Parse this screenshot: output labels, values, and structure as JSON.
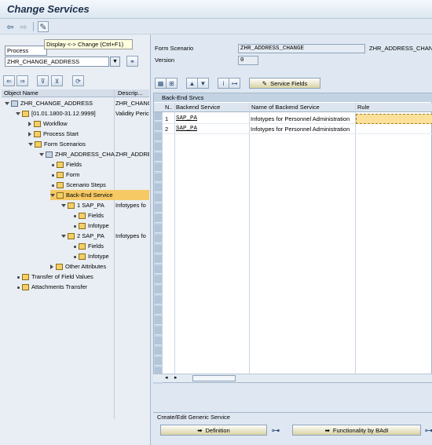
{
  "app": {
    "title": "Change Services"
  },
  "tooltip": "Display <-> Change   (Ctrl+F1)",
  "left": {
    "object_type": "Process",
    "object_value": "ZHR_CHANGE_ADDRESS",
    "tree_headers": {
      "object": "Object Name",
      "desc": "Descrip..."
    },
    "tree": [
      {
        "label": "ZHR_CHANGE_ADDRESS",
        "desc": "ZHR_CHANG"
      },
      {
        "label": "[01.01.1800-31.12.9999]",
        "desc": "Validity Peric"
      },
      {
        "label": "Workflow",
        "desc": ""
      },
      {
        "label": "Process Start",
        "desc": ""
      },
      {
        "label": "Form Scenarios",
        "desc": ""
      },
      {
        "label": "ZHR_ADDRESS_CHA",
        "desc": "ZHR_ADDRE"
      },
      {
        "label": "Fields",
        "desc": ""
      },
      {
        "label": "Form",
        "desc": ""
      },
      {
        "label": "Scenario Steps",
        "desc": ""
      },
      {
        "label": "Back-End Service",
        "desc": ""
      },
      {
        "label": "1 SAP_PA",
        "desc": "Infotypes fo"
      },
      {
        "label": "Fields",
        "desc": ""
      },
      {
        "label": "Infotype",
        "desc": ""
      },
      {
        "label": "2 SAP_PA",
        "desc": "Infotypes fo"
      },
      {
        "label": "Fields",
        "desc": ""
      },
      {
        "label": "Infotype",
        "desc": ""
      },
      {
        "label": "Other Attributes",
        "desc": ""
      },
      {
        "label": "Transfer of Field Values",
        "desc": ""
      },
      {
        "label": "Attachments Transfer",
        "desc": ""
      }
    ]
  },
  "form": {
    "scenario_label": "Form Scenario",
    "scenario_value": "ZHR_ADDRESS_CHANGE",
    "scenario_desc": "ZHR_ADDRESS_CHANGE",
    "version_label": "Version",
    "version_value": "0"
  },
  "buttons": {
    "service_fields": "Service Fields",
    "definition": "Definition",
    "functionality": "Functionality by BAdI"
  },
  "grid": {
    "title": "Back-End Srvcs",
    "columns": [
      "N..",
      "Backend Service",
      "Name of Backend Service",
      "Rule"
    ],
    "rows": [
      {
        "n": "1",
        "service": "SAP_PA",
        "name": "Infotypes for Personnel Administration",
        "rule": ""
      },
      {
        "n": "2",
        "service": "SAP_PA",
        "name": "Infotypes for Personnel Administration",
        "rule": ""
      }
    ]
  },
  "bottom": {
    "title": "Create/Edit Generic Service"
  }
}
